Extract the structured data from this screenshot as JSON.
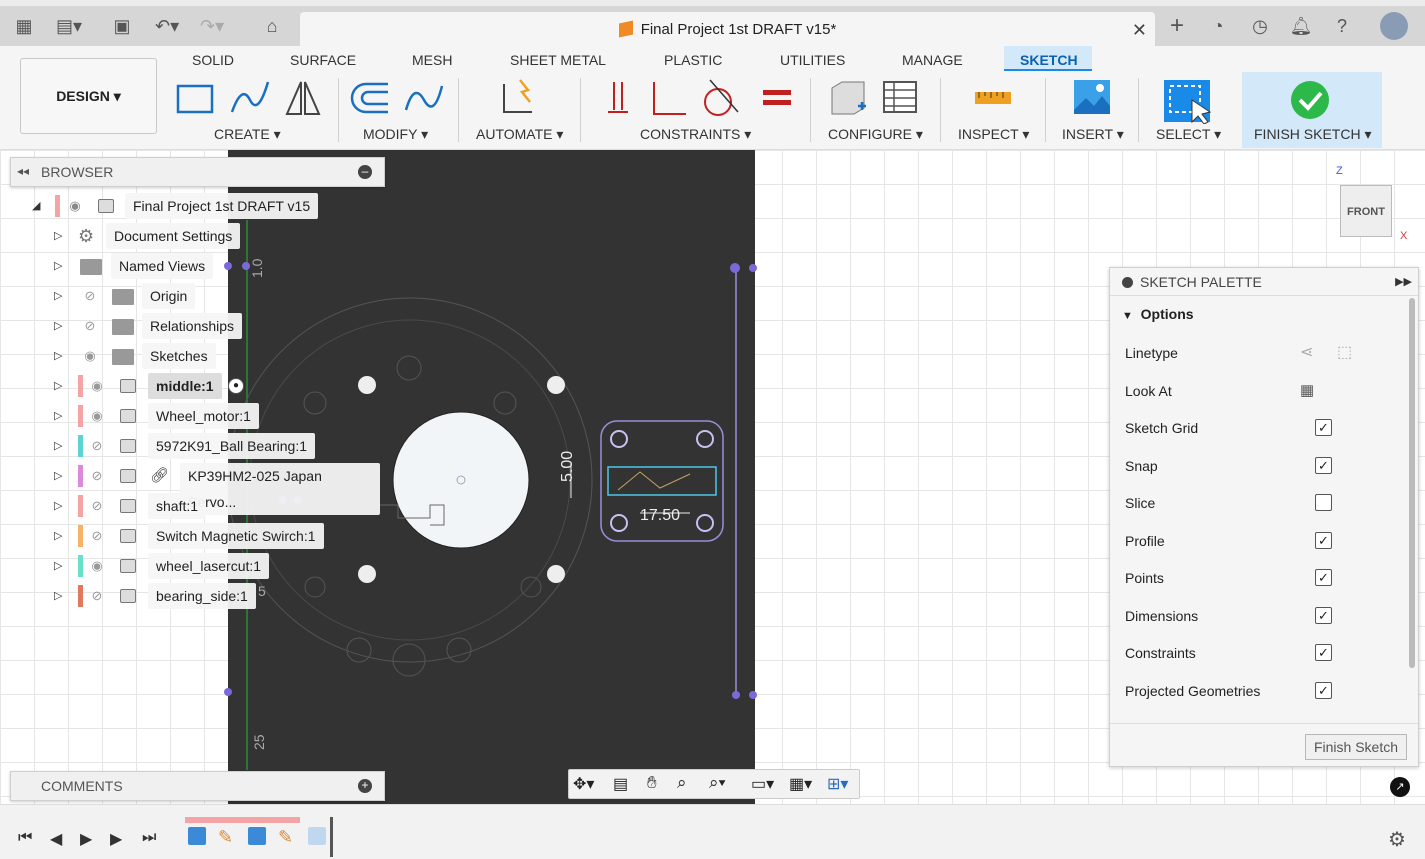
{
  "document": {
    "title": "Final Project 1st DRAFT v15*"
  },
  "toolbar": {
    "workspace": "DESIGN",
    "tabs": [
      "SOLID",
      "SURFACE",
      "MESH",
      "SHEET METAL",
      "PLASTIC",
      "UTILITIES",
      "MANAGE",
      "SKETCH"
    ],
    "groups": [
      "CREATE",
      "MODIFY",
      "AUTOMATE",
      "CONSTRAINTS",
      "CONFIGURE",
      "INSPECT",
      "INSERT",
      "SELECT",
      "FINISH SKETCH"
    ],
    "accent": "#1a8ae8"
  },
  "browser": {
    "title": "BROWSER",
    "root": "Final Project 1st DRAFT v15",
    "items": [
      {
        "label": "Document Settings",
        "color": ""
      },
      {
        "label": "Named Views",
        "color": ""
      },
      {
        "label": "Origin",
        "color": ""
      },
      {
        "label": "Relationships",
        "color": ""
      },
      {
        "label": "Sketches",
        "color": ""
      },
      {
        "label": "middle:1",
        "color": "#f4a4a4"
      },
      {
        "label": "Wheel_motor:1",
        "color": "#f4a4a4"
      },
      {
        "label": "5972K91_Ball Bearing:1",
        "color": "#5fd3d3"
      },
      {
        "label": "KP39HM2-025 Japan Servo...",
        "color": "#d98ad9"
      },
      {
        "label": "shaft:1",
        "color": "#f4a4a4"
      },
      {
        "label": "Switch Magnetic Swirch:1",
        "color": "#f7b26a"
      },
      {
        "label": "wheel_lasercut:1",
        "color": "#6ae0c8"
      },
      {
        "label": "bearing_side:1",
        "color": "#e07a5f"
      }
    ]
  },
  "comments": {
    "title": "COMMENTS"
  },
  "palette": {
    "title": "SKETCH PALETTE",
    "section": "Options",
    "options": [
      {
        "label": "Linetype"
      },
      {
        "label": "Look At"
      },
      {
        "label": "Sketch Grid",
        "checked": "✓"
      },
      {
        "label": "Snap",
        "checked": "✓"
      },
      {
        "label": "Slice",
        "checked": ""
      },
      {
        "label": "Profile",
        "checked": "✓"
      },
      {
        "label": "Points",
        "checked": "✓"
      },
      {
        "label": "Dimensions",
        "checked": "✓"
      },
      {
        "label": "Constraints",
        "checked": "✓"
      },
      {
        "label": "Projected Geometries",
        "checked": "✓"
      }
    ],
    "finish_label": "Finish Sketch"
  },
  "canvas": {
    "dims": {
      "d1": "5.00",
      "d2": "17.50",
      "d3": "1.0",
      "d4": "25",
      "d5": "5"
    },
    "viewcube": {
      "face": "FRONT",
      "axis_z": "Z",
      "axis_x": "X"
    }
  }
}
